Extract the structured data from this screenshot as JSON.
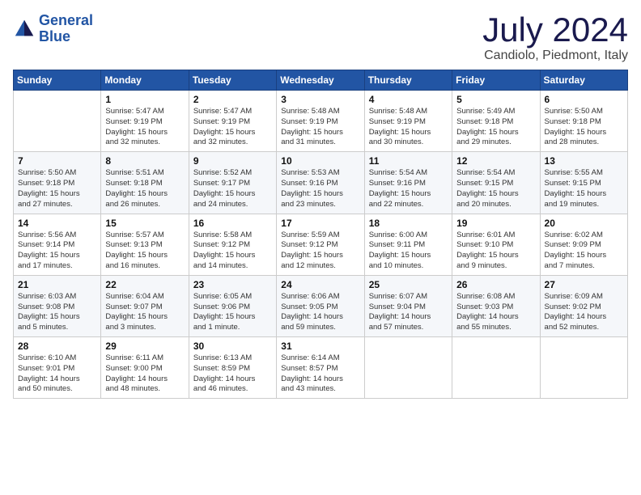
{
  "header": {
    "logo_line1": "General",
    "logo_line2": "Blue",
    "month_title": "July 2024",
    "location": "Candiolo, Piedmont, Italy"
  },
  "days_of_week": [
    "Sunday",
    "Monday",
    "Tuesday",
    "Wednesday",
    "Thursday",
    "Friday",
    "Saturday"
  ],
  "weeks": [
    [
      {
        "day": "",
        "info": ""
      },
      {
        "day": "1",
        "info": "Sunrise: 5:47 AM\nSunset: 9:19 PM\nDaylight: 15 hours\nand 32 minutes."
      },
      {
        "day": "2",
        "info": "Sunrise: 5:47 AM\nSunset: 9:19 PM\nDaylight: 15 hours\nand 32 minutes."
      },
      {
        "day": "3",
        "info": "Sunrise: 5:48 AM\nSunset: 9:19 PM\nDaylight: 15 hours\nand 31 minutes."
      },
      {
        "day": "4",
        "info": "Sunrise: 5:48 AM\nSunset: 9:19 PM\nDaylight: 15 hours\nand 30 minutes."
      },
      {
        "day": "5",
        "info": "Sunrise: 5:49 AM\nSunset: 9:18 PM\nDaylight: 15 hours\nand 29 minutes."
      },
      {
        "day": "6",
        "info": "Sunrise: 5:50 AM\nSunset: 9:18 PM\nDaylight: 15 hours\nand 28 minutes."
      }
    ],
    [
      {
        "day": "7",
        "info": "Sunrise: 5:50 AM\nSunset: 9:18 PM\nDaylight: 15 hours\nand 27 minutes."
      },
      {
        "day": "8",
        "info": "Sunrise: 5:51 AM\nSunset: 9:18 PM\nDaylight: 15 hours\nand 26 minutes."
      },
      {
        "day": "9",
        "info": "Sunrise: 5:52 AM\nSunset: 9:17 PM\nDaylight: 15 hours\nand 24 minutes."
      },
      {
        "day": "10",
        "info": "Sunrise: 5:53 AM\nSunset: 9:16 PM\nDaylight: 15 hours\nand 23 minutes."
      },
      {
        "day": "11",
        "info": "Sunrise: 5:54 AM\nSunset: 9:16 PM\nDaylight: 15 hours\nand 22 minutes."
      },
      {
        "day": "12",
        "info": "Sunrise: 5:54 AM\nSunset: 9:15 PM\nDaylight: 15 hours\nand 20 minutes."
      },
      {
        "day": "13",
        "info": "Sunrise: 5:55 AM\nSunset: 9:15 PM\nDaylight: 15 hours\nand 19 minutes."
      }
    ],
    [
      {
        "day": "14",
        "info": "Sunrise: 5:56 AM\nSunset: 9:14 PM\nDaylight: 15 hours\nand 17 minutes."
      },
      {
        "day": "15",
        "info": "Sunrise: 5:57 AM\nSunset: 9:13 PM\nDaylight: 15 hours\nand 16 minutes."
      },
      {
        "day": "16",
        "info": "Sunrise: 5:58 AM\nSunset: 9:12 PM\nDaylight: 15 hours\nand 14 minutes."
      },
      {
        "day": "17",
        "info": "Sunrise: 5:59 AM\nSunset: 9:12 PM\nDaylight: 15 hours\nand 12 minutes."
      },
      {
        "day": "18",
        "info": "Sunrise: 6:00 AM\nSunset: 9:11 PM\nDaylight: 15 hours\nand 10 minutes."
      },
      {
        "day": "19",
        "info": "Sunrise: 6:01 AM\nSunset: 9:10 PM\nDaylight: 15 hours\nand 9 minutes."
      },
      {
        "day": "20",
        "info": "Sunrise: 6:02 AM\nSunset: 9:09 PM\nDaylight: 15 hours\nand 7 minutes."
      }
    ],
    [
      {
        "day": "21",
        "info": "Sunrise: 6:03 AM\nSunset: 9:08 PM\nDaylight: 15 hours\nand 5 minutes."
      },
      {
        "day": "22",
        "info": "Sunrise: 6:04 AM\nSunset: 9:07 PM\nDaylight: 15 hours\nand 3 minutes."
      },
      {
        "day": "23",
        "info": "Sunrise: 6:05 AM\nSunset: 9:06 PM\nDaylight: 15 hours\nand 1 minute."
      },
      {
        "day": "24",
        "info": "Sunrise: 6:06 AM\nSunset: 9:05 PM\nDaylight: 14 hours\nand 59 minutes."
      },
      {
        "day": "25",
        "info": "Sunrise: 6:07 AM\nSunset: 9:04 PM\nDaylight: 14 hours\nand 57 minutes."
      },
      {
        "day": "26",
        "info": "Sunrise: 6:08 AM\nSunset: 9:03 PM\nDaylight: 14 hours\nand 55 minutes."
      },
      {
        "day": "27",
        "info": "Sunrise: 6:09 AM\nSunset: 9:02 PM\nDaylight: 14 hours\nand 52 minutes."
      }
    ],
    [
      {
        "day": "28",
        "info": "Sunrise: 6:10 AM\nSunset: 9:01 PM\nDaylight: 14 hours\nand 50 minutes."
      },
      {
        "day": "29",
        "info": "Sunrise: 6:11 AM\nSunset: 9:00 PM\nDaylight: 14 hours\nand 48 minutes."
      },
      {
        "day": "30",
        "info": "Sunrise: 6:13 AM\nSunset: 8:59 PM\nDaylight: 14 hours\nand 46 minutes."
      },
      {
        "day": "31",
        "info": "Sunrise: 6:14 AM\nSunset: 8:57 PM\nDaylight: 14 hours\nand 43 minutes."
      },
      {
        "day": "",
        "info": ""
      },
      {
        "day": "",
        "info": ""
      },
      {
        "day": "",
        "info": ""
      }
    ]
  ]
}
